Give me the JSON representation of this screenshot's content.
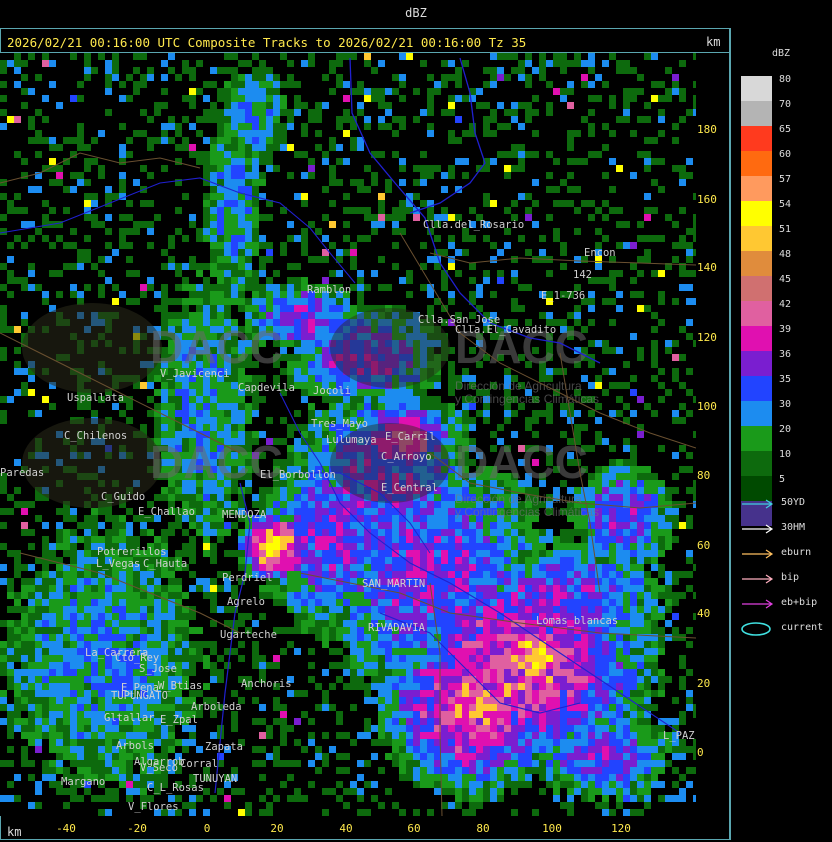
{
  "window": {
    "top_title": "dBZ"
  },
  "header": {
    "text": "2026/02/21 00:16:00 UTC Composite Tracks to 2026/02/21 00:16:00 Tz 35",
    "km_top": "km",
    "km_bottom": "km"
  },
  "axes": {
    "y_ticks": [
      "180",
      "160",
      "140",
      "120",
      "100",
      "80",
      "60",
      "40",
      "20",
      "0"
    ],
    "x_ticks": [
      "-40",
      "-20",
      "0",
      "20",
      "40",
      "60",
      "80",
      "100",
      "120"
    ]
  },
  "legend": {
    "title": "dBZ",
    "levels": [
      {
        "label": "80",
        "color": "#d8d8d8"
      },
      {
        "label": "70",
        "color": "#b4b4b4"
      },
      {
        "label": "65",
        "color": "#ff3a1e"
      },
      {
        "label": "60",
        "color": "#ff6a10"
      },
      {
        "label": "57",
        "color": "#ff9a5e"
      },
      {
        "label": "54",
        "color": "#ffff00"
      },
      {
        "label": "51",
        "color": "#ffc832"
      },
      {
        "label": "48",
        "color": "#e08c3c"
      },
      {
        "label": "45",
        "color": "#d07070"
      },
      {
        "label": "42",
        "color": "#e060a0"
      },
      {
        "label": "39",
        "color": "#e010b0"
      },
      {
        "label": "36",
        "color": "#7a1ed0"
      },
      {
        "label": "35",
        "color": "#2244ff"
      },
      {
        "label": "30",
        "color": "#1c8cf0"
      },
      {
        "label": "20",
        "color": "#1a9a1a"
      },
      {
        "label": "10",
        "color": "#0d6a0d"
      },
      {
        "label": "5",
        "color": "#004a00"
      },
      {
        "label": "",
        "color": "#46328c"
      }
    ],
    "tracks": [
      {
        "label": "50YD",
        "color": "#40d0e0"
      },
      {
        "label": "30HM",
        "color": "#ffffff"
      },
      {
        "label": "eburn",
        "color": "#ffc060"
      },
      {
        "label": "bip",
        "color": "#ffb0c0"
      },
      {
        "label": "eb+bip",
        "color": "#e040e0"
      },
      {
        "label": "current",
        "color": "#40e0e0"
      }
    ]
  },
  "places": [
    "Clla.del_Rosario",
    "Encon",
    "142",
    "E_1-736",
    "Ramblon",
    "Clla.San_Jose",
    "Clla.El_Cavadito",
    "V_Javicenci",
    "Uspallata",
    "Capdevila",
    "Jocoli",
    "Tres_Mayo",
    "Lulumaya",
    "C_Chilenos",
    "E_Carril",
    "C_Arroyo",
    "Paredas",
    "E_Central",
    "C_Guido",
    "E_Challao",
    "MENDOZA",
    "Potrerillos",
    "L_Vegas",
    "C_Hauta",
    "Perdriel",
    "Agrelo",
    "Ugarteche",
    "SAN_MARTIN",
    "RIVADAVIA",
    "Lomas_blancas",
    "La_Carrera",
    "Cto_Rey",
    "S_Jose",
    "E_Pena",
    "W_Btias",
    "TUPUNGATO",
    "Anchoris",
    "Arboleda",
    "Gltallar",
    "E_Zpal",
    "Arbols",
    "Zapata",
    "Algarrob",
    "V_Seco",
    "Corral",
    "Margano",
    "TUNUYAN",
    "C_L_Rosas",
    "V_Flores",
    "L_PAZ",
    "El_Borbollon"
  ],
  "watermark": {
    "brand": "DACC",
    "line1": "Dirección de Agricultura",
    "line2": "y Contingencias Climáticas"
  }
}
